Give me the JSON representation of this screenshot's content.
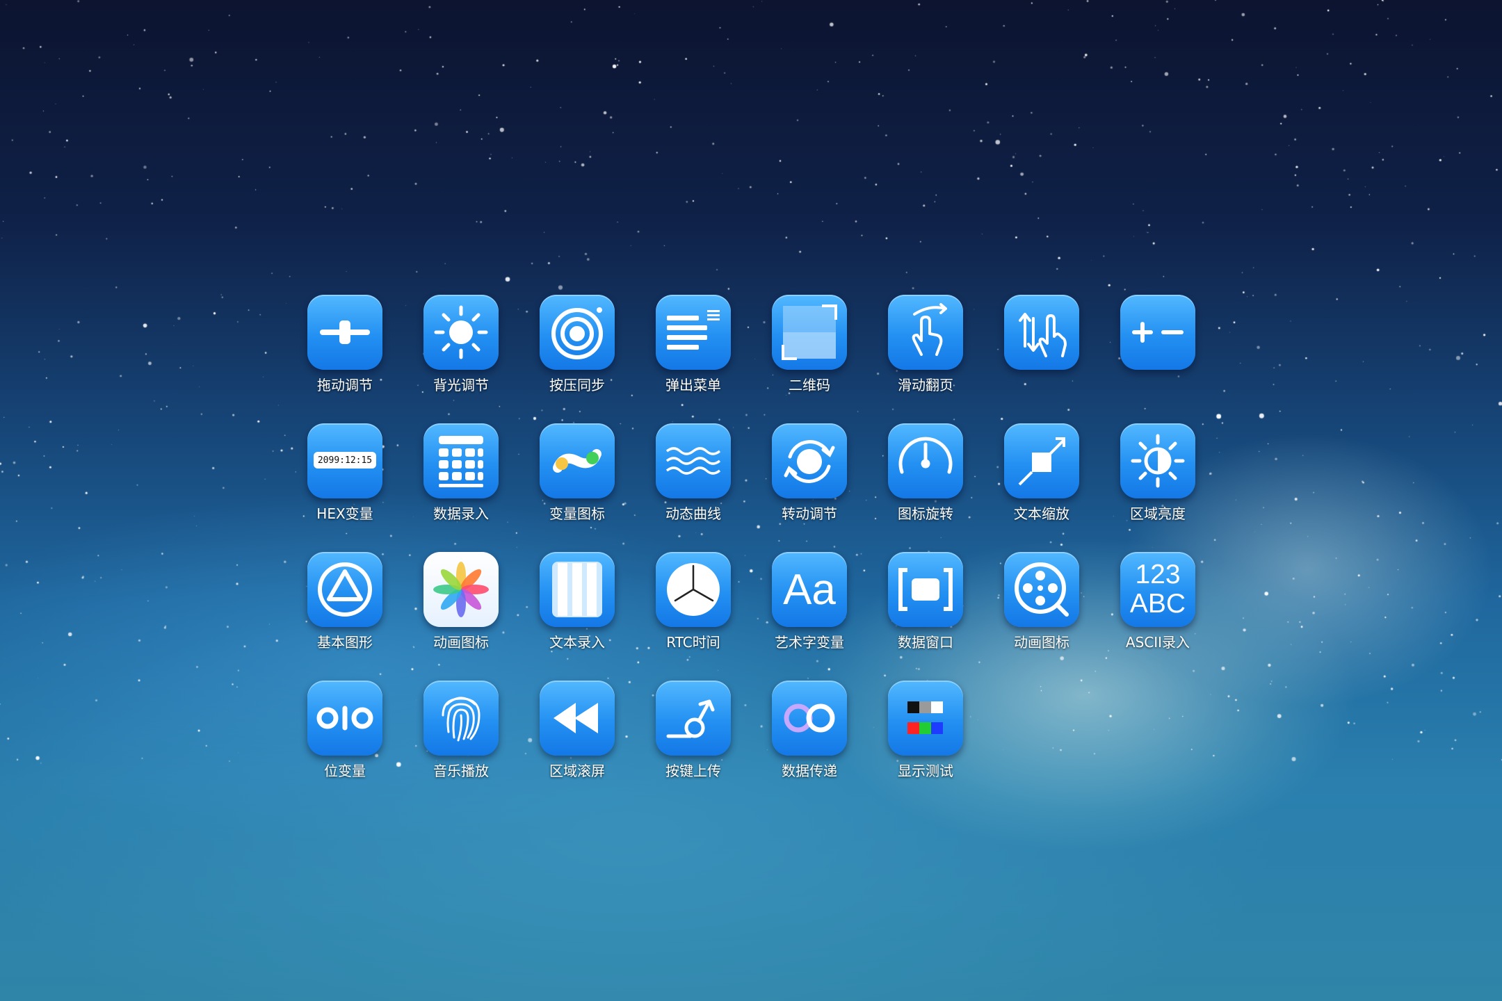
{
  "desktop": {
    "apps": [
      {
        "label": "拖动调节",
        "icon": "slider-icon"
      },
      {
        "label": "背光调节",
        "icon": "sun-icon"
      },
      {
        "label": "按压同步",
        "icon": "target-rings-icon"
      },
      {
        "label": "弹出菜单",
        "icon": "menu-list-icon"
      },
      {
        "label": "二维码",
        "icon": "qr-frame-icon"
      },
      {
        "label": "滑动翻页",
        "icon": "swipe-hand-icon"
      },
      {
        "label": "",
        "icon": "scroll-hand-icon"
      },
      {
        "label": "",
        "icon": "plus-minus-icon"
      },
      {
        "label": "HEX变量",
        "icon": "hex-clock-icon",
        "display": "2099:12:15"
      },
      {
        "label": "数据录入",
        "icon": "keypad-icon"
      },
      {
        "label": "变量图标",
        "icon": "toggle-dots-icon"
      },
      {
        "label": "动态曲线",
        "icon": "waves-icon"
      },
      {
        "label": "转动调节",
        "icon": "rotate-knob-icon"
      },
      {
        "label": "图标旋转",
        "icon": "gauge-icon"
      },
      {
        "label": "文本缩放",
        "icon": "resize-arrow-icon"
      },
      {
        "label": "区域亮度",
        "icon": "half-sun-icon"
      },
      {
        "label": "基本图形",
        "icon": "triangle-circle-icon"
      },
      {
        "label": "动画图标",
        "icon": "pinwheel-icon"
      },
      {
        "label": "文本录入",
        "icon": "text-columns-icon"
      },
      {
        "label": "RTC时间",
        "icon": "clock-icon"
      },
      {
        "label": "艺术字变量",
        "icon": "font-aa-icon",
        "glyph": "Aa"
      },
      {
        "label": "数据窗口",
        "icon": "window-brackets-icon"
      },
      {
        "label": "动画图标",
        "icon": "film-reel-icon"
      },
      {
        "label": "ASCII录入",
        "icon": "ascii-icon",
        "line1": "123",
        "line2": "ABC"
      },
      {
        "label": "位变量",
        "icon": "bit-toggle-icon"
      },
      {
        "label": "音乐播放",
        "icon": "fingerprint-icon"
      },
      {
        "label": "区域滚屏",
        "icon": "rewind-icon"
      },
      {
        "label": "按键上传",
        "icon": "press-upload-icon"
      },
      {
        "label": "数据传递",
        "icon": "infinity-icon"
      },
      {
        "label": "显示测试",
        "icon": "color-test-icon"
      }
    ]
  },
  "colors": {
    "tile_top": "#52b8ff",
    "tile_bottom": "#1478e6",
    "label": "#ffffff"
  }
}
